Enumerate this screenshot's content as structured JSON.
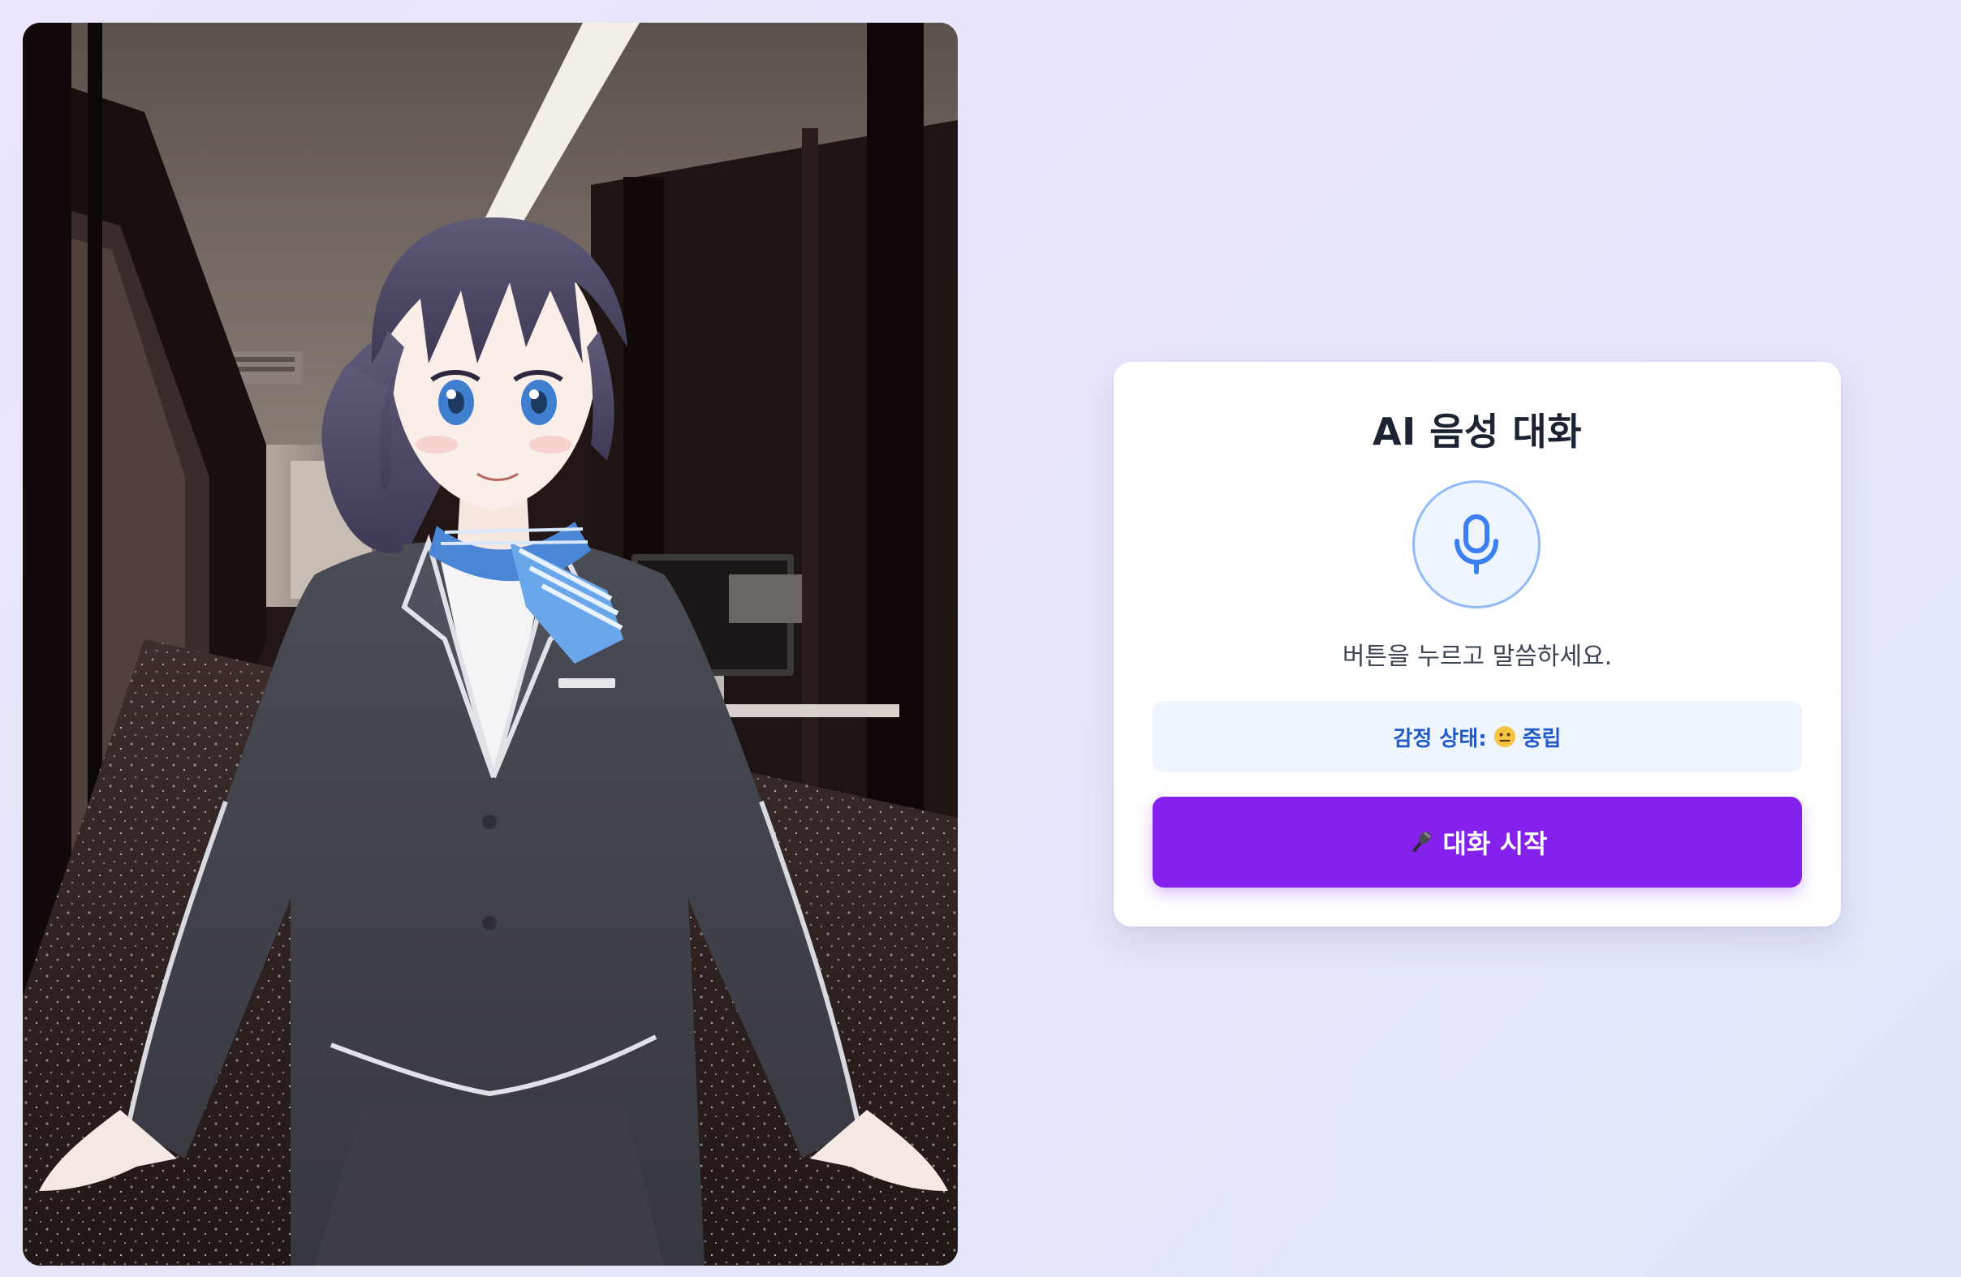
{
  "chat": {
    "title": "AI 음성 대화",
    "prompt": "버튼을 누르고 말씀하세요.",
    "emotion_label": "감정 상태:",
    "emotion_icon": "neutral-face-emoji",
    "emotion_value": "중립",
    "start_button_icon": "microphone-emoji",
    "start_button_label": "대화 시작"
  },
  "colors": {
    "accent": "#8421ec",
    "mic_blue": "#3b7ff2",
    "status_text": "#2358c7",
    "title_text": "#1c2333"
  },
  "avatar": {
    "description_icon": "anime-avatar-character",
    "background_icon": "office-interior-photo"
  }
}
